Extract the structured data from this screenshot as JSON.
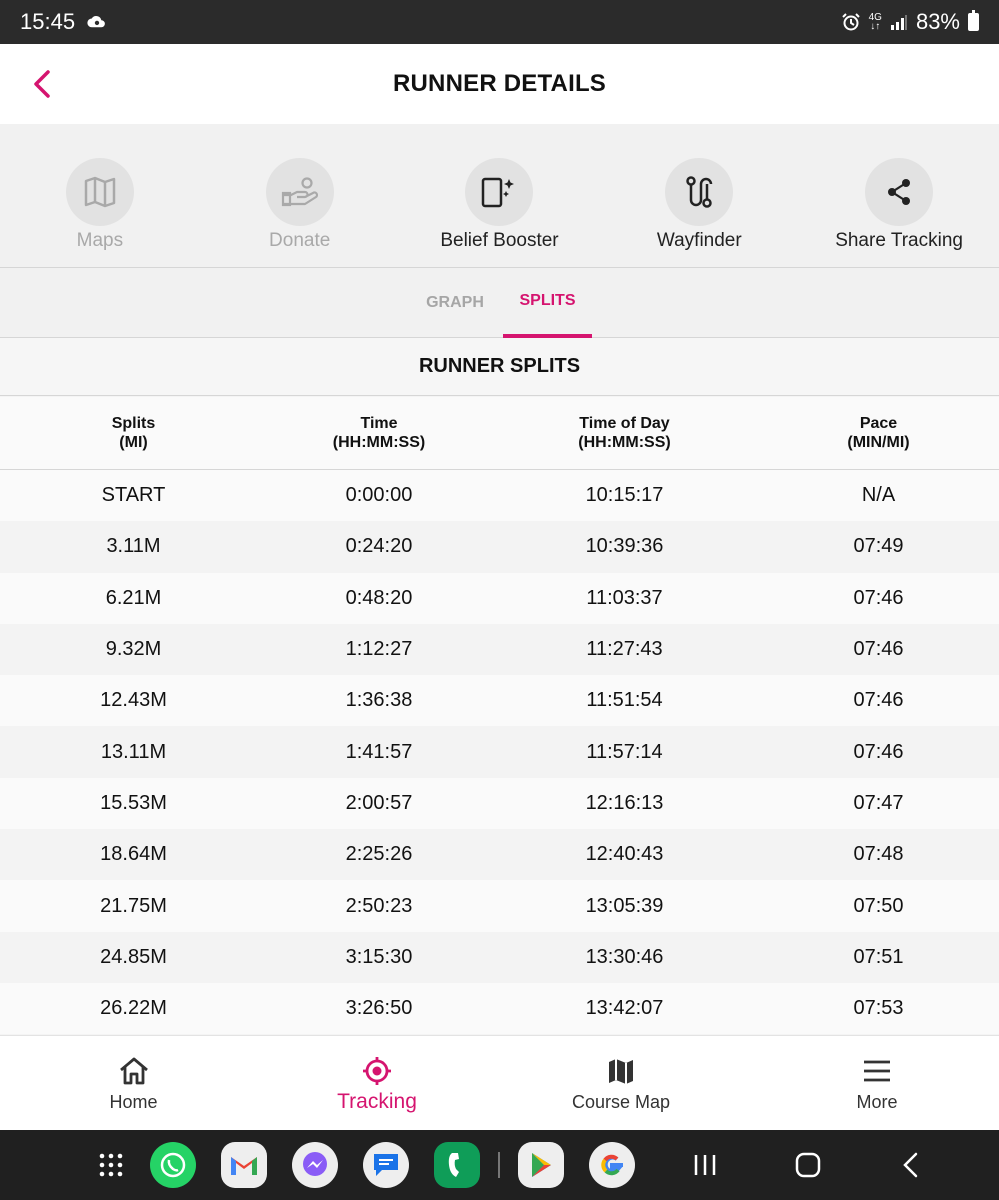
{
  "status": {
    "time": "15:45",
    "network": "4G",
    "battery": "83%"
  },
  "header": {
    "title": "RUNNER DETAILS"
  },
  "actions": [
    {
      "label": "Maps",
      "icon": "map-icon",
      "enabled": false
    },
    {
      "label": "Donate",
      "icon": "donate-hand-icon",
      "enabled": false
    },
    {
      "label": "Belief Booster",
      "icon": "phone-sparkle-icon",
      "enabled": true
    },
    {
      "label": "Wayfinder",
      "icon": "route-icon",
      "enabled": true
    },
    {
      "label": "Share Tracking",
      "icon": "share-icon",
      "enabled": true
    }
  ],
  "tabs": {
    "graph": "GRAPH",
    "splits": "SPLITS",
    "active": "SPLITS"
  },
  "splits_title": "RUNNER SPLITS",
  "table": {
    "headers": [
      {
        "line1": "Splits",
        "line2": "(MI)"
      },
      {
        "line1": "Time",
        "line2": "(HH:MM:SS)"
      },
      {
        "line1": "Time of Day",
        "line2": "(HH:MM:SS)"
      },
      {
        "line1": "Pace",
        "line2": "(MIN/MI)"
      }
    ],
    "rows": [
      [
        "START",
        "0:00:00",
        "10:15:17",
        "N/A"
      ],
      [
        "3.11M",
        "0:24:20",
        "10:39:36",
        "07:49"
      ],
      [
        "6.21M",
        "0:48:20",
        "11:03:37",
        "07:46"
      ],
      [
        "9.32M",
        "1:12:27",
        "11:27:43",
        "07:46"
      ],
      [
        "12.43M",
        "1:36:38",
        "11:51:54",
        "07:46"
      ],
      [
        "13.11M",
        "1:41:57",
        "11:57:14",
        "07:46"
      ],
      [
        "15.53M",
        "2:00:57",
        "12:16:13",
        "07:47"
      ],
      [
        "18.64M",
        "2:25:26",
        "12:40:43",
        "07:48"
      ],
      [
        "21.75M",
        "2:50:23",
        "13:05:39",
        "07:50"
      ],
      [
        "24.85M",
        "3:15:30",
        "13:30:46",
        "07:51"
      ],
      [
        "26.22M",
        "3:26:50",
        "13:42:07",
        "07:53"
      ]
    ]
  },
  "bottom_nav": [
    {
      "label": "Home",
      "icon": "home-icon"
    },
    {
      "label": "Tracking",
      "icon": "target-icon",
      "active": true
    },
    {
      "label": "Course Map",
      "icon": "map-icon"
    },
    {
      "label": "More",
      "icon": "hamburger-icon"
    }
  ],
  "colors": {
    "accent": "#d5146f",
    "disabled": "#a9a9a9"
  }
}
